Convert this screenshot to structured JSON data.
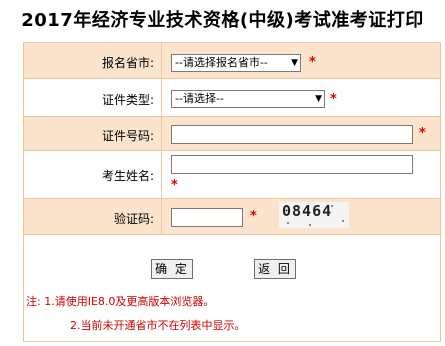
{
  "page": {
    "title": "2017年经济专业技术资格(中级)考试准考证打印"
  },
  "form": {
    "province": {
      "label": "报名省市:",
      "selected": "--请选择报名省市--",
      "required_mark": "*"
    },
    "id_type": {
      "label": "证件类型:",
      "selected": "--请选择--",
      "required_mark": "*"
    },
    "id_number": {
      "label": "证件号码:",
      "value": "",
      "required_mark": "*"
    },
    "name": {
      "label": "考生姓名:",
      "value": "",
      "required_mark": "*"
    },
    "captcha": {
      "label": "验证码:",
      "value": "",
      "required_mark": "*",
      "image_text": "08464"
    }
  },
  "buttons": {
    "confirm_label": "确 定",
    "back_label": "返 回"
  },
  "notes": {
    "line1": "注: 1.请使用IE8.0及更高版本浏览器。",
    "line2": "2.当前未开通省市不在列表中显示。"
  },
  "colors": {
    "shade": "#fbe3cc",
    "border": "#e8c9a7",
    "required": "#e00000"
  }
}
